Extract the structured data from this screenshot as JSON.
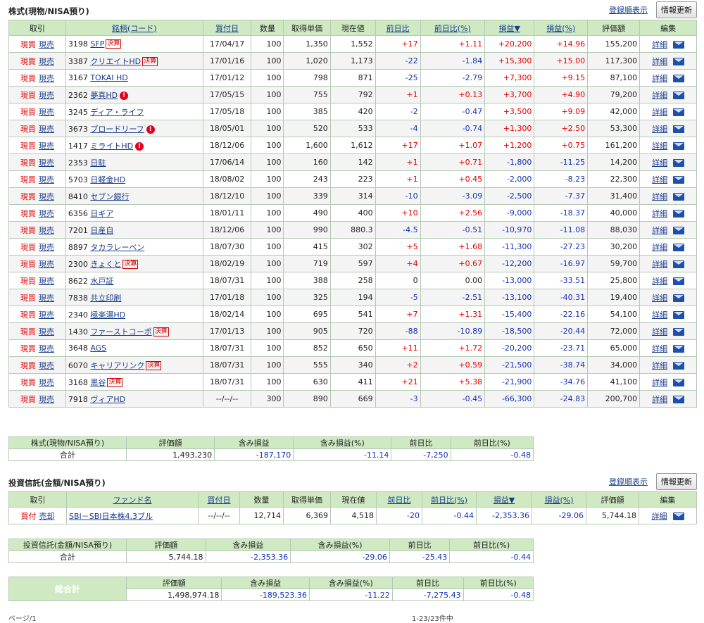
{
  "stocks": {
    "title": "株式(現物/NISA預り)",
    "reg_link": "登録順表示",
    "refresh": "情報更新",
    "headers": [
      "取引",
      "銘柄(コード)",
      "買付日",
      "数量",
      "取得単価",
      "現在値",
      "前日比",
      "前日比(%)",
      "損益▼",
      "損益(%)",
      "評価額",
      "編集"
    ],
    "buy": "現買",
    "sell": "現売",
    "detail": "詳細",
    "rows": [
      {
        "code": "3198",
        "name": "SFP",
        "tag": "決算",
        "alert": false,
        "date": "17/04/17",
        "qty": "100",
        "cost": "1,350",
        "price": "1,552",
        "chg": "+17",
        "chgp": "+1.11",
        "pl": "+20,200",
        "plp": "+14.96",
        "val": "155,200"
      },
      {
        "code": "3387",
        "name": "クリエイトHD",
        "tag": "決算",
        "alert": false,
        "date": "17/01/16",
        "qty": "100",
        "cost": "1,020",
        "price": "1,173",
        "chg": "-22",
        "chgp": "-1.84",
        "pl": "+15,300",
        "plp": "+15.00",
        "val": "117,300"
      },
      {
        "code": "3167",
        "name": "TOKAI HD",
        "tag": "",
        "alert": false,
        "date": "17/01/12",
        "qty": "100",
        "cost": "798",
        "price": "871",
        "chg": "-25",
        "chgp": "-2.79",
        "pl": "+7,300",
        "plp": "+9.15",
        "val": "87,100"
      },
      {
        "code": "2362",
        "name": "夢真HD",
        "tag": "",
        "alert": true,
        "date": "17/05/15",
        "qty": "100",
        "cost": "755",
        "price": "792",
        "chg": "+1",
        "chgp": "+0.13",
        "pl": "+3,700",
        "plp": "+4.90",
        "val": "79,200"
      },
      {
        "code": "3245",
        "name": "ディア・ライフ",
        "tag": "",
        "alert": false,
        "date": "17/05/18",
        "qty": "100",
        "cost": "385",
        "price": "420",
        "chg": "-2",
        "chgp": "-0.47",
        "pl": "+3,500",
        "plp": "+9.09",
        "val": "42,000"
      },
      {
        "code": "3673",
        "name": "ブロードリーフ",
        "tag": "",
        "alert": true,
        "date": "18/05/01",
        "qty": "100",
        "cost": "520",
        "price": "533",
        "chg": "-4",
        "chgp": "-0.74",
        "pl": "+1,300",
        "plp": "+2.50",
        "val": "53,300"
      },
      {
        "code": "1417",
        "name": "ミライトHD",
        "tag": "",
        "alert": true,
        "date": "18/12/06",
        "qty": "100",
        "cost": "1,600",
        "price": "1,612",
        "chg": "+17",
        "chgp": "+1.07",
        "pl": "+1,200",
        "plp": "+0.75",
        "val": "161,200"
      },
      {
        "code": "2353",
        "name": "日駐",
        "tag": "",
        "alert": false,
        "date": "17/06/14",
        "qty": "100",
        "cost": "160",
        "price": "142",
        "chg": "+1",
        "chgp": "+0.71",
        "pl": "-1,800",
        "plp": "-11.25",
        "val": "14,200"
      },
      {
        "code": "5703",
        "name": "日軽金HD",
        "tag": "",
        "alert": false,
        "date": "18/08/02",
        "qty": "100",
        "cost": "243",
        "price": "223",
        "chg": "+1",
        "chgp": "+0.45",
        "pl": "-2,000",
        "plp": "-8.23",
        "val": "22,300"
      },
      {
        "code": "8410",
        "name": "セブン銀行",
        "tag": "",
        "alert": false,
        "date": "18/12/10",
        "qty": "100",
        "cost": "339",
        "price": "314",
        "chg": "-10",
        "chgp": "-3.09",
        "pl": "-2,500",
        "plp": "-7.37",
        "val": "31,400"
      },
      {
        "code": "6356",
        "name": "日ギア",
        "tag": "",
        "alert": false,
        "date": "18/01/11",
        "qty": "100",
        "cost": "490",
        "price": "400",
        "chg": "+10",
        "chgp": "+2.56",
        "pl": "-9,000",
        "plp": "-18.37",
        "val": "40,000"
      },
      {
        "code": "7201",
        "name": "日産自",
        "tag": "",
        "alert": false,
        "date": "18/12/06",
        "qty": "100",
        "cost": "990",
        "price": "880.3",
        "chg": "-4.5",
        "chgp": "-0.51",
        "pl": "-10,970",
        "plp": "-11.08",
        "val": "88,030"
      },
      {
        "code": "8897",
        "name": "タカラレーベン",
        "tag": "",
        "alert": false,
        "date": "18/07/30",
        "qty": "100",
        "cost": "415",
        "price": "302",
        "chg": "+5",
        "chgp": "+1.68",
        "pl": "-11,300",
        "plp": "-27.23",
        "val": "30,200"
      },
      {
        "code": "2300",
        "name": "きょくと",
        "tag": "決算",
        "alert": false,
        "date": "18/02/19",
        "qty": "100",
        "cost": "719",
        "price": "597",
        "chg": "+4",
        "chgp": "+0.67",
        "pl": "-12,200",
        "plp": "-16.97",
        "val": "59,700"
      },
      {
        "code": "8622",
        "name": "水戸証",
        "tag": "",
        "alert": false,
        "date": "18/07/31",
        "qty": "100",
        "cost": "388",
        "price": "258",
        "chg": "0",
        "chgp": "0.00",
        "pl": "-13,000",
        "plp": "-33.51",
        "val": "25,800"
      },
      {
        "code": "7838",
        "name": "共立印刷",
        "tag": "",
        "alert": false,
        "date": "17/01/18",
        "qty": "100",
        "cost": "325",
        "price": "194",
        "chg": "-5",
        "chgp": "-2.51",
        "pl": "-13,100",
        "plp": "-40.31",
        "val": "19,400"
      },
      {
        "code": "2340",
        "name": "極楽湯HD",
        "tag": "",
        "alert": false,
        "date": "18/02/14",
        "qty": "100",
        "cost": "695",
        "price": "541",
        "chg": "+7",
        "chgp": "+1.31",
        "pl": "-15,400",
        "plp": "-22.16",
        "val": "54,100"
      },
      {
        "code": "1430",
        "name": "ファーストコーポ",
        "tag": "決算",
        "alert": false,
        "date": "17/01/13",
        "qty": "100",
        "cost": "905",
        "price": "720",
        "chg": "-88",
        "chgp": "-10.89",
        "pl": "-18,500",
        "plp": "-20.44",
        "val": "72,000"
      },
      {
        "code": "3648",
        "name": "AGS",
        "tag": "",
        "alert": false,
        "date": "18/07/31",
        "qty": "100",
        "cost": "852",
        "price": "650",
        "chg": "+11",
        "chgp": "+1.72",
        "pl": "-20,200",
        "plp": "-23.71",
        "val": "65,000"
      },
      {
        "code": "6070",
        "name": "キャリアリンク",
        "tag": "決算",
        "alert": false,
        "date": "18/07/31",
        "qty": "100",
        "cost": "555",
        "price": "340",
        "chg": "+2",
        "chgp": "+0.59",
        "pl": "-21,500",
        "plp": "-38.74",
        "val": "34,000"
      },
      {
        "code": "3168",
        "name": "黒谷",
        "tag": "決算",
        "alert": false,
        "date": "18/07/31",
        "qty": "100",
        "cost": "630",
        "price": "411",
        "chg": "+21",
        "chgp": "+5.38",
        "pl": "-21,900",
        "plp": "-34.76",
        "val": "41,100"
      },
      {
        "code": "7918",
        "name": "ヴィアHD",
        "tag": "",
        "alert": false,
        "date": "--/--/--",
        "qty": "300",
        "cost": "890",
        "price": "669",
        "chg": "-3",
        "chgp": "-0.45",
        "pl": "-66,300",
        "plp": "-24.83",
        "val": "200,700"
      }
    ],
    "summary": {
      "label1": "株式(現物/NISA預り)",
      "label2": "合計",
      "headers": [
        "評価額",
        "含み損益",
        "含み損益(%)",
        "前日比",
        "前日比(%)"
      ],
      "values": [
        "1,493,230",
        "-187,170",
        "-11.14",
        "-7,250",
        "-0.48"
      ]
    }
  },
  "funds": {
    "title": "投資信託(金額/NISA預り)",
    "reg_link": "登録順表示",
    "refresh": "情報更新",
    "headers": [
      "取引",
      "ファンド名",
      "買付日",
      "数量",
      "取得単価",
      "現在値",
      "前日比",
      "前日比(%)",
      "損益▼",
      "損益(%)",
      "評価額",
      "編集"
    ],
    "buy": "買付",
    "sell": "売却",
    "detail": "詳細",
    "rows": [
      {
        "name": "SBI－SBI日本株4.3ブル",
        "date": "--/--/--",
        "qty": "12,714",
        "cost": "6,369",
        "price": "4,518",
        "chg": "-20",
        "chgp": "-0.44",
        "pl": "-2,353.36",
        "plp": "-29.06",
        "val": "5,744.18"
      }
    ],
    "summary": {
      "label1": "投資信託(金額/NISA預り)",
      "label2": "合計",
      "headers": [
        "評価額",
        "含み損益",
        "含み損益(%)",
        "前日比",
        "前日比(%)"
      ],
      "values": [
        "5,744.18",
        "-2,353.36",
        "-29.06",
        "-25.43",
        "-0.44"
      ]
    }
  },
  "total": {
    "label": "総合計",
    "headers": [
      "評価額",
      "含み損益",
      "含み損益(%)",
      "前日比",
      "前日比(%)"
    ],
    "values": [
      "1,498,974.18",
      "-189,523.36",
      "-11.22",
      "-7,275.43",
      "-0.48"
    ]
  },
  "footer": {
    "left": "ページ/1",
    "right": "1-23/23件中"
  },
  "colors": {
    "header_bg": "#cfeac3",
    "total_bg": "#7dbd6b",
    "positive": "#e10000",
    "negative": "#1432b5",
    "link": "#1a3c8c"
  }
}
